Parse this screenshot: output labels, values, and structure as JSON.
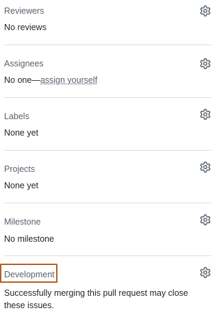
{
  "reviewers": {
    "title": "Reviewers",
    "value": "No reviews"
  },
  "assignees": {
    "title": "Assignees",
    "value_prefix": "No one—",
    "assign_link": "assign yourself"
  },
  "labels": {
    "title": "Labels",
    "value": "None yet"
  },
  "projects": {
    "title": "Projects",
    "value": "None yet"
  },
  "milestone": {
    "title": "Milestone",
    "value": "No milestone"
  },
  "development": {
    "title": "Development",
    "value": "Successfully merging this pull request may close these issues."
  },
  "icons": {
    "settings": "gear-icon"
  },
  "colors": {
    "highlight": "#b45e1e",
    "divider": "#d8dee4",
    "muted": "#59636e"
  }
}
